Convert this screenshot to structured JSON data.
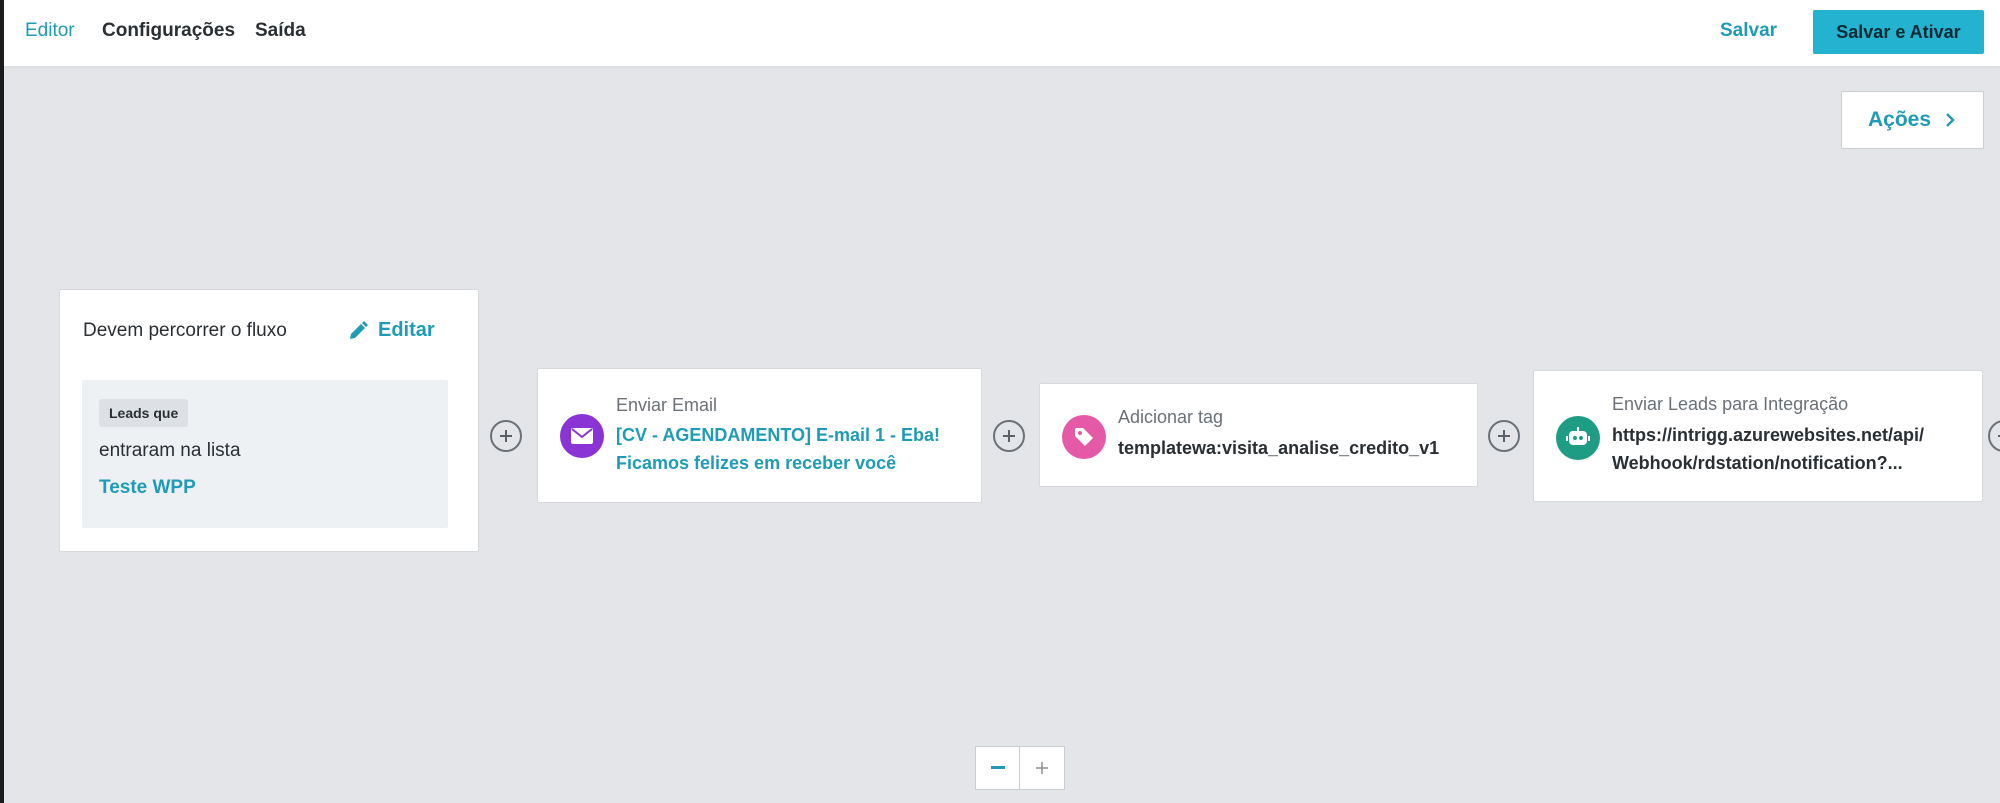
{
  "nav": {
    "tabs": [
      {
        "label": "Editor",
        "active": true
      },
      {
        "label": "Configurações",
        "active": false
      },
      {
        "label": "Saída",
        "active": false
      }
    ],
    "save_label": "Salvar",
    "save_activate_label": "Salvar e Ativar"
  },
  "actions": {
    "label": "Ações",
    "icon": "chevron-right-icon"
  },
  "start": {
    "title": "Devem percorrer o fluxo",
    "edit_label": "Editar",
    "badge": "Leads que",
    "condition": "entraram na lista",
    "list_name": "Teste WPP"
  },
  "steps": [
    {
      "label": "Enviar Email",
      "value": "[CV - AGENDAMENTO] E-mail 1 - Eba! Ficamos felizes em receber você",
      "icon": "envelope-icon",
      "color": "#8a34d6"
    },
    {
      "label": "Adicionar tag",
      "value": "templatewa:visita_analise_credito_v1",
      "icon": "tag-icon",
      "color": "#e45aa6"
    },
    {
      "label": "Enviar Leads para Integração",
      "value": "https://intrigg.azurewebsites.net/api/ Webhook/rdstation/notification?...",
      "icon": "robot-icon",
      "color": "#1e9d84"
    }
  ],
  "zoom": {
    "out_label": "−",
    "in_label": "+"
  },
  "colors": {
    "accent": "#1f9bb6",
    "primary_button": "#23b2cf",
    "canvas": "#e3e5e8"
  }
}
